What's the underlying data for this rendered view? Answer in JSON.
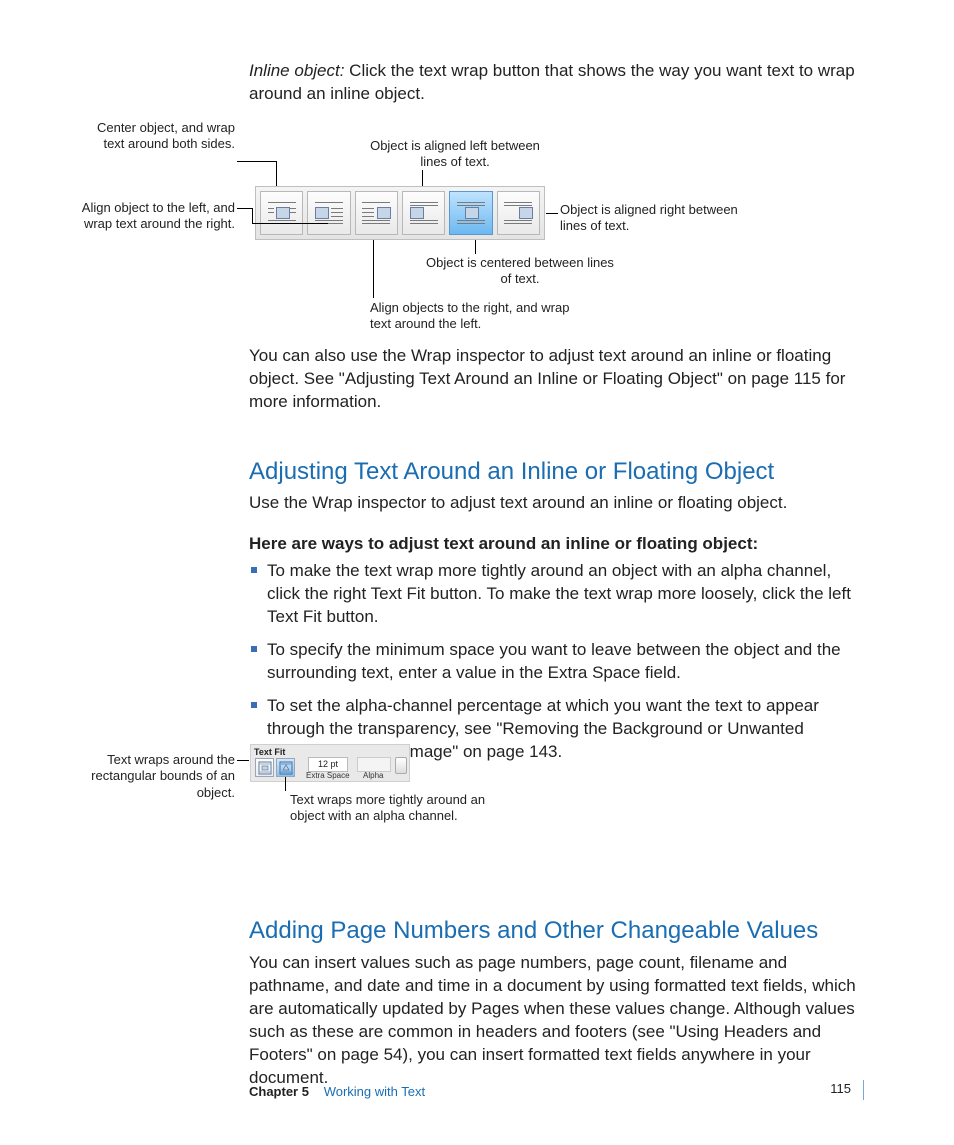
{
  "intro": {
    "lead": "Inline object:",
    "rest": "  Click the text wrap button that shows the way you want text to wrap around an inline object."
  },
  "fig1": {
    "captions": {
      "centerBoth": "Center object, and wrap text around both sides.",
      "alignLeftWrapRight": "Align object to the left, and wrap text around the right.",
      "objAlignedLeft": "Object is aligned left between lines of text.",
      "objAlignedRight": "Object is aligned right between lines of text.",
      "objCentered": "Object is centered between lines of text.",
      "alignRightWrapLeft": "Align objects to the right, and wrap text around the left."
    }
  },
  "afterFig1": "You can also use the Wrap inspector to adjust text around an inline or floating object. See \"Adjusting Text Around an Inline or Floating Object\" on page 115 for more information.",
  "section1": {
    "heading": "Adjusting Text Around an Inline or Floating Object",
    "sub": "Use the Wrap inspector to adjust text around an inline or floating object.",
    "bold": "Here are ways to adjust text around an inline or floating object:",
    "bullets": [
      "To make the text wrap more tightly around an object with an alpha channel, click the right Text Fit button. To make the text wrap more loosely, click the left Text Fit button.",
      "To specify the minimum space you want to leave between the object and the surrounding text, enter a value in the Extra Space field.",
      "To set the alpha-channel percentage at which you want the text to appear through the transparency, see \"Removing the Background or Unwanted Elements from an Image\" on page 143."
    ]
  },
  "fig2": {
    "panelTitle": "Text Fit",
    "extraSpaceValue": "12 pt",
    "extraSpaceLabel": "Extra Space",
    "alphaLabel": "Alpha",
    "captionLeft": "Text wraps around the rectangular bounds of an object.",
    "captionBelow": "Text wraps more tightly around an object with an alpha channel."
  },
  "section2": {
    "heading": "Adding Page Numbers and Other Changeable Values",
    "body": "You can insert values such as page numbers, page count, filename and pathname, and date and time in a document by using formatted text fields, which are automatically updated by Pages when these values change. Although values such as these are common in headers and footers (see \"Using Headers and Footers\" on page 54), you can insert formatted text fields anywhere in your document."
  },
  "footer": {
    "chapter": "Chapter 5",
    "title": "Working with Text",
    "page": "115"
  }
}
